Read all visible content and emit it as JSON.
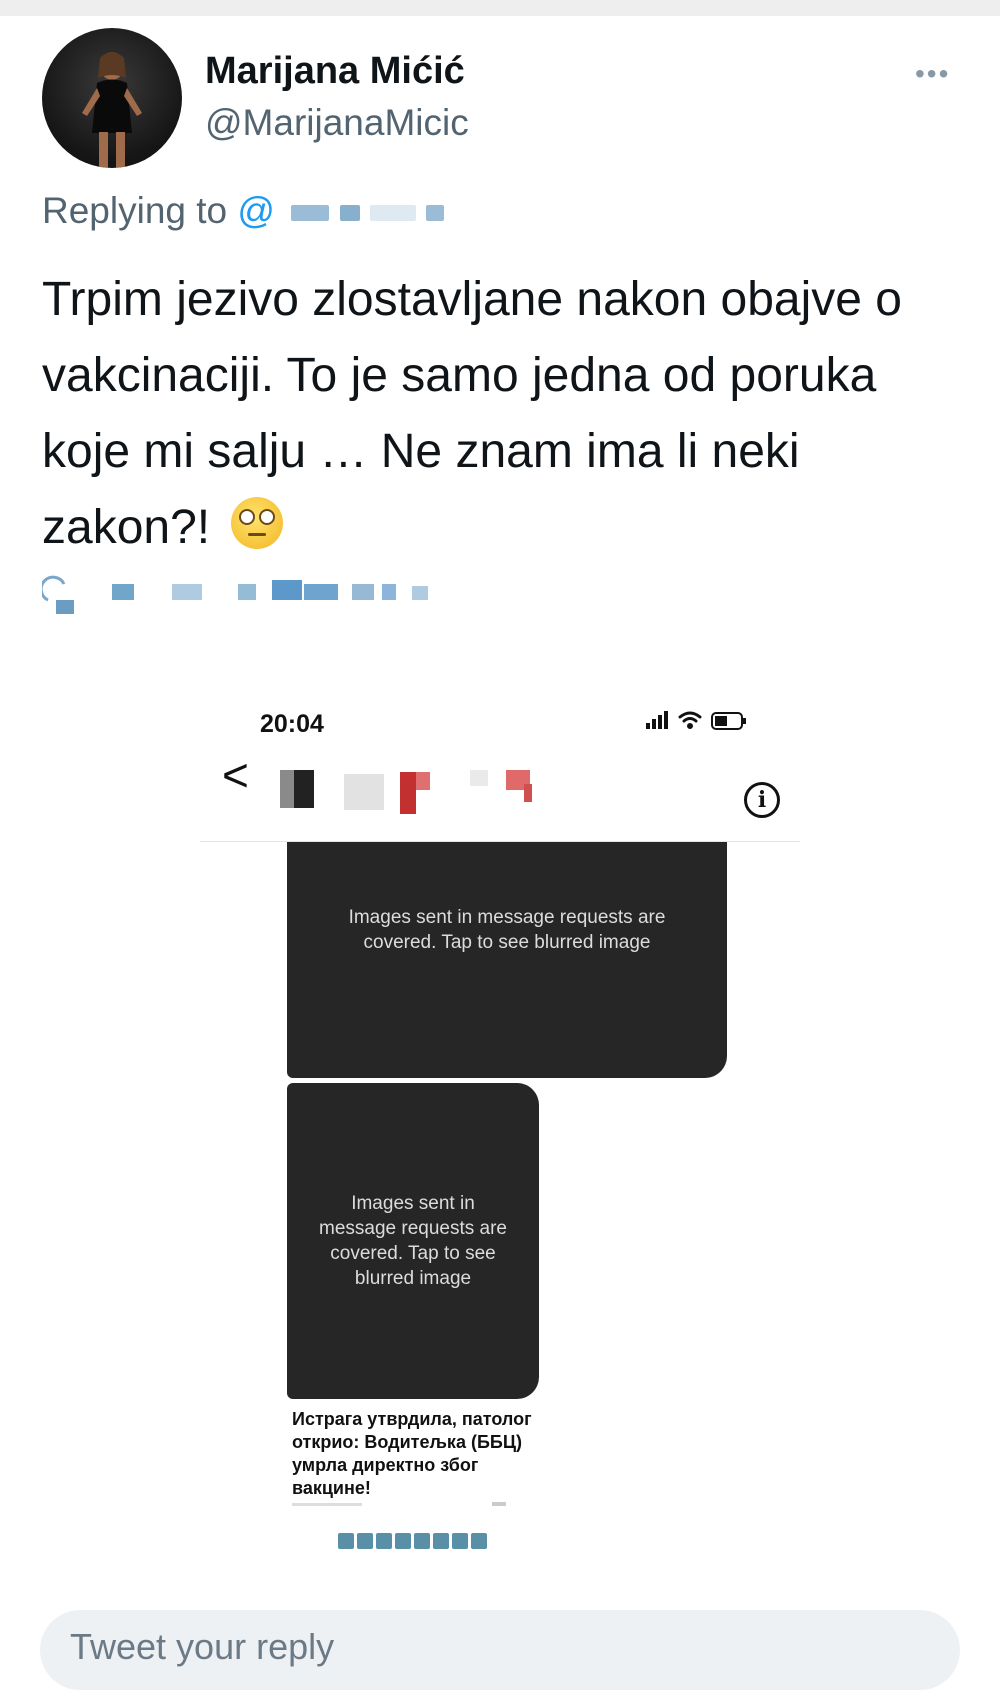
{
  "tweet": {
    "author_name": "Marijana Mićić",
    "author_handle": "@MarijanaMicic",
    "more_label": "•••",
    "replying_label": "Replying to",
    "replying_at": "@",
    "text": "Trpim jezivo zlostavljane nakon obajve o vakcinaciji. To je samo jedna od poruka koje mi salju  … Ne znam ima li neki zakon?!",
    "emoji": "face-with-rolling-eyes"
  },
  "screenshot": {
    "status_time": "20:04",
    "back_label": "<",
    "info_label": "i",
    "bubble1_text": "Images sent in message requests are covered. Tap to see blurred image",
    "bubble2_text": "Images sent in message requests are covered. Tap to see blurred image",
    "link_title": "Истрага утврдила, патолог открио: Водитељка (ББЦ) умрла директно због вакцине!"
  },
  "composer": {
    "placeholder": "Tweet your reply"
  },
  "icons": {
    "more": "more-horizontal-icon",
    "back": "chevron-left-icon",
    "info": "info-icon",
    "signal": "signal-icon",
    "wifi": "wifi-icon",
    "battery": "battery-icon"
  }
}
